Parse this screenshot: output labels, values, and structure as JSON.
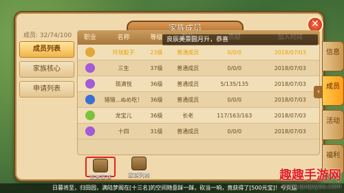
{
  "title": "家族成员",
  "member_count": "成员: 32/74/100",
  "sidebar": [
    "成员列表",
    "家族核心",
    "申请列表"
  ],
  "table_headers": [
    "职业",
    "名称",
    "等级",
    "职位",
    "贡献",
    "加入时间"
  ],
  "rows": [
    {
      "name": "玲珑骰子",
      "level": "23级",
      "position": "普通成员",
      "contribution": "0/0/0",
      "date": "2018/07/03",
      "highlight": true,
      "icon_color": "#e0a836"
    },
    {
      "name": "三生",
      "level": "37级",
      "position": "普通成员",
      "contribution": "0/0/0",
      "date": "2018/07/03",
      "highlight": false,
      "icon_color": "#a35bd7"
    },
    {
      "name": "琐满悦",
      "level": "36级",
      "position": "普通成员",
      "contribution": "5/135/135",
      "date": "2018/07/03",
      "highlight": false,
      "icon_color": "#a35bd7"
    },
    {
      "name": "猎猎...ぬめ吃！",
      "level": "36级",
      "position": "普通成员",
      "contribution": "0/0/0",
      "date": "2018/07/03",
      "highlight": false,
      "icon_color": "#3c6ed4"
    },
    {
      "name": "龙宝儿",
      "level": "36级",
      "position": "长老",
      "contribution": "117/163/163",
      "date": "2018/07/03",
      "highlight": false,
      "icon_color": "#7bc23f"
    },
    {
      "name": "十四",
      "level": "31级",
      "position": "普通成员",
      "contribution": "0/0/0",
      "date": "2018/07/03",
      "highlight": false,
      "icon_color": "#a35bd7"
    }
  ],
  "notice": "良辰美景圆月升，恭喜",
  "bottom_buttons": [
    "脱离家族",
    "家族列表"
  ],
  "right_tabs": [
    "信息",
    "成员",
    "活动",
    "福利"
  ],
  "ticker": "日暮将至，归田园，满陆梦阁在[十三名]的空间随意踩一踩，砍当一响，竟获得了[500元宝]！今天运",
  "watermark": {
    "title": "趣趣手游网",
    "url": "www.ququyou.com"
  }
}
